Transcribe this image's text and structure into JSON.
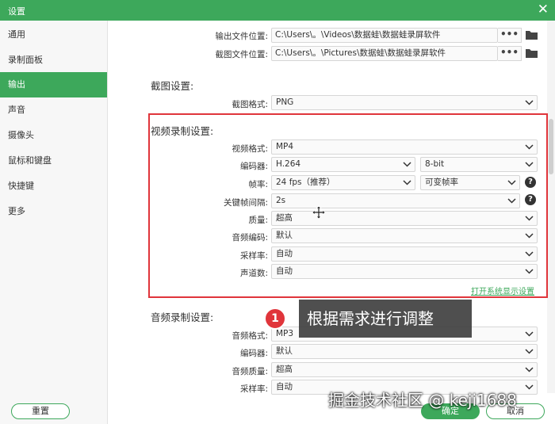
{
  "window": {
    "title": "设置",
    "close_glyph": "✕"
  },
  "sidebar": {
    "items": [
      {
        "label": "通用"
      },
      {
        "label": "录制面板"
      },
      {
        "label": "输出",
        "active": true
      },
      {
        "label": "声音"
      },
      {
        "label": "摄像头"
      },
      {
        "label": "鼠标和键盘"
      },
      {
        "label": "快捷键"
      },
      {
        "label": "更多"
      }
    ]
  },
  "output_paths": {
    "output_label": "输出文件位置:",
    "output_value": "C:\\Users\\。\\Videos\\数据蛙\\数据蛙录屏软件",
    "screenshot_label": "截图文件位置:",
    "screenshot_value": "C:\\Users\\。\\Pictures\\数据蛙\\数据蛙录屏软件",
    "dots": "•••"
  },
  "screenshot_settings": {
    "title": "截图设置:",
    "format_label": "截图格式:",
    "format_value": "PNG"
  },
  "video_settings": {
    "title": "视频录制设置:",
    "format_label": "视频格式:",
    "format_value": "MP4",
    "encoder_label": "编码器:",
    "encoder_value": "H.264",
    "bitdepth_value": "8-bit",
    "framerate_label": "帧率:",
    "framerate_value": "24 fps（推荐）",
    "framerate_mode_value": "可变帧率",
    "keyframe_label": "关键帧间隔:",
    "keyframe_value": "2s",
    "quality_label": "质量:",
    "quality_value": "超高",
    "audio_codec_label": "音频编码:",
    "audio_codec_value": "默认",
    "sample_rate_label": "采样率:",
    "sample_rate_value": "自动",
    "channels_label": "声道数:",
    "channels_value": "自动",
    "system_display_link": "打开系统显示设置",
    "help_glyph": "?"
  },
  "audio_settings": {
    "title": "音频录制设置:",
    "format_label": "音频格式:",
    "format_value": "MP3",
    "encoder_label": "编码器:",
    "encoder_value": "默认",
    "quality_label": "音频质量:",
    "quality_value": "超高",
    "sample_rate_label": "采样率:",
    "sample_rate_value": "自动"
  },
  "annotation": {
    "badge": "1",
    "text": "根据需求进行调整"
  },
  "footer": {
    "reset_label": "重置",
    "ok_label": "确定",
    "cancel_label": "取消"
  },
  "watermark": "掘金技术社区 @ keji1688",
  "colors": {
    "accent": "#3da85b",
    "highlight": "#e0353b"
  },
  "icons": [
    "close-icon",
    "folder-icon",
    "chevron-down-icon",
    "help-icon",
    "move-cursor-icon"
  ]
}
